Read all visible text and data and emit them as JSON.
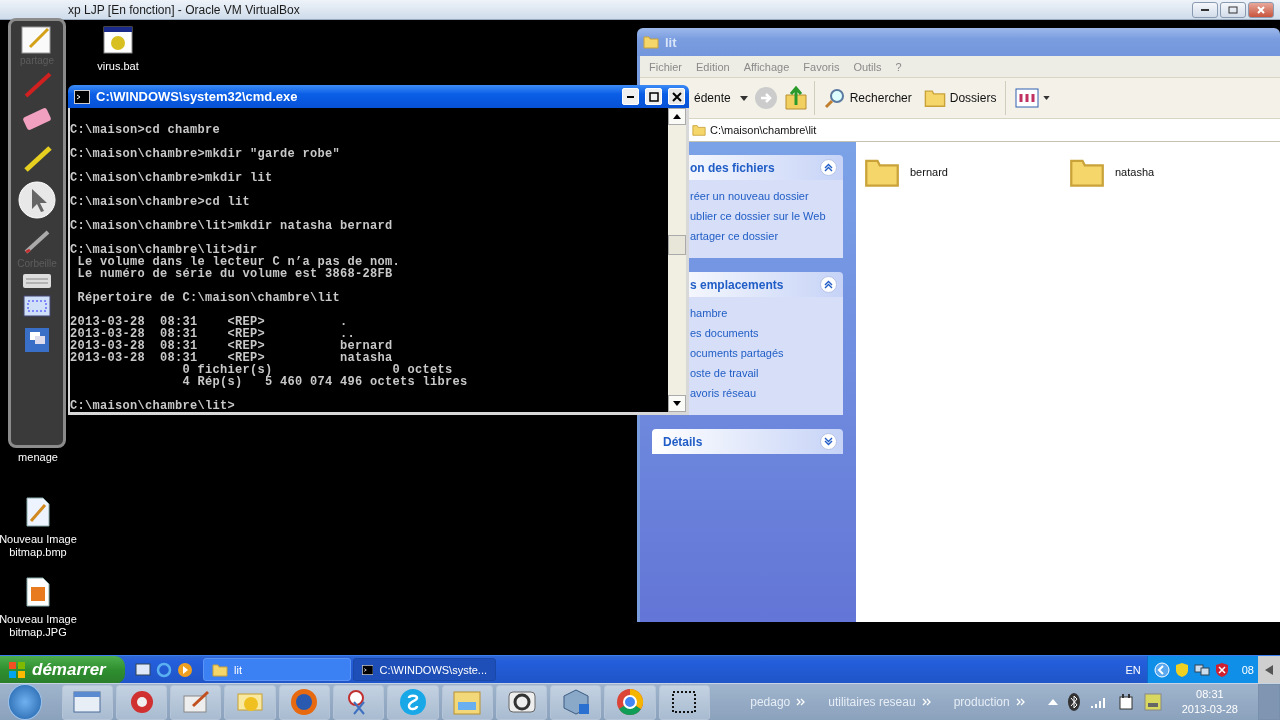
{
  "host_window": {
    "title": "xp LJP [En fonction] - Oracle VM VirtualBox"
  },
  "pen_toolbar": {
    "labels": [
      "partage",
      "Corbeille"
    ]
  },
  "desktop_icons": [
    {
      "label": "virus.bat",
      "kind": "batch"
    },
    {
      "label": "menage",
      "kind": "covered"
    },
    {
      "label": "Nouveau Image bitmap.bmp",
      "kind": "bmp"
    },
    {
      "label": "Nouveau Image bitmap.JPG",
      "kind": "jpg"
    }
  ],
  "cmd": {
    "title": "C:\\WINDOWS\\system32\\cmd.exe",
    "active": true,
    "blocks": [
      [
        "C:\\maison>cd chambre"
      ],
      [
        "C:\\maison\\chambre>mkdir \"garde robe\""
      ],
      [
        "C:\\maison\\chambre>mkdir lit"
      ],
      [
        "C:\\maison\\chambre>cd lit"
      ],
      [
        "C:\\maison\\chambre\\lit>mkdir natasha bernard"
      ],
      [
        "C:\\maison\\chambre\\lit>dir",
        " Le volume dans le lecteur C n’a pas de nom.",
        " Le numéro de série du volume est 3868-28FB"
      ],
      [
        " Répertoire de C:\\maison\\chambre\\lit"
      ],
      [
        "2013-03-28  08:31    <REP>          .",
        "2013-03-28  08:31    <REP>          ..",
        "2013-03-28  08:31    <REP>          bernard",
        "2013-03-28  08:31    <REP>          natasha",
        "               0 fichier(s)                0 octets",
        "               4 Rép(s)   5 460 074 496 octets libres"
      ],
      [
        "C:\\maison\\chambre\\lit>"
      ]
    ]
  },
  "explorer": {
    "title": "lit",
    "active": false,
    "menu": [
      "Fichier",
      "Edition",
      "Affichage",
      "Favoris",
      "Outils",
      "?"
    ],
    "toolbar": {
      "back_label": "édente",
      "search_label": "Rechercher",
      "folders_label": "Dossiers"
    },
    "address": "C:\\maison\\chambre\\lit",
    "panels": [
      {
        "title": "on des fichiers",
        "expanded": true,
        "links": [
          "réer un nouveau dossier",
          "ublier ce dossier sur le Web",
          "artager ce dossier"
        ]
      },
      {
        "title": "s emplacements",
        "expanded": true,
        "links": [
          "hambre",
          "es documents",
          "ocuments partagés",
          "oste de travail",
          "avoris réseau"
        ]
      },
      {
        "title": "Détails",
        "expanded": false
      }
    ],
    "files": [
      "bernard",
      "natasha"
    ]
  },
  "xp_taskbar": {
    "start_label": "démarrer",
    "tasks": [
      {
        "label": "lit",
        "kind": "folder",
        "selected": false
      },
      {
        "label": "C:\\WINDOWS\\syste...",
        "kind": "console",
        "selected": true
      }
    ],
    "language": "EN",
    "clock": "08"
  },
  "host_taskbar": {
    "toolbars": [
      "pedago",
      "utilitaires reseau",
      "production"
    ],
    "time": "08:31",
    "date": "2013-03-28"
  }
}
